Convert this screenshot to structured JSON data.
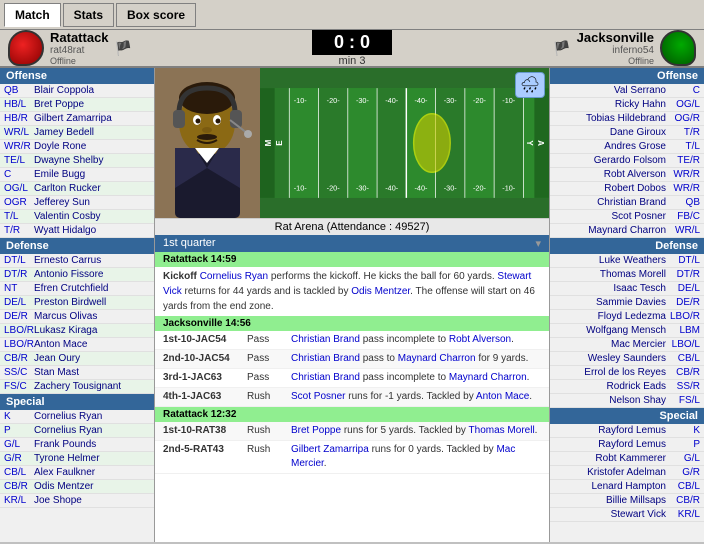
{
  "tabs": [
    {
      "id": "match",
      "label": "Match",
      "active": true
    },
    {
      "id": "stats",
      "label": "Stats",
      "active": false
    },
    {
      "id": "box-score",
      "label": "Box score",
      "active": false
    }
  ],
  "header": {
    "left_team": "Ratattack",
    "left_user": "rat48rat",
    "left_status": "Offline",
    "right_team": "Jacksonville",
    "right_user": "inferno54",
    "right_status": "Offline",
    "score": "0 : 0",
    "time": "min 3"
  },
  "venue": "Rat Arena (Attendance : 49527)",
  "weather_icon": "🌧",
  "left_offense": {
    "header": "Offense",
    "players": [
      {
        "pos": "QB",
        "name": "Blair Coppola"
      },
      {
        "pos": "HB/L",
        "name": "Bret Poppe"
      },
      {
        "pos": "HB/R",
        "name": "Gilbert Zamarripa"
      },
      {
        "pos": "WR/L",
        "name": "Jamey Bedell"
      },
      {
        "pos": "WR/R",
        "name": "Doyle Rone"
      },
      {
        "pos": "TE/L",
        "name": "Dwayne Shelby"
      },
      {
        "pos": "C",
        "name": "Emile Bugg"
      },
      {
        "pos": "OG/L",
        "name": "Carlton Rucker"
      },
      {
        "pos": "OGR",
        "name": "Jefferey Sun"
      },
      {
        "pos": "T/L",
        "name": "Valentin Cosby"
      },
      {
        "pos": "T/R",
        "name": "Wyatt Hidalgo"
      }
    ]
  },
  "left_defense": {
    "header": "Defense",
    "players": [
      {
        "pos": "DT/L",
        "name": "Ernesto Carrus"
      },
      {
        "pos": "DT/R",
        "name": "Antonio Fissore"
      },
      {
        "pos": "NT",
        "name": "Efren Crutchfield"
      },
      {
        "pos": "DE/L",
        "name": "Preston Birdwell"
      },
      {
        "pos": "DE/R",
        "name": "Marcus Olivas"
      },
      {
        "pos": "LBO/R",
        "name": "Lukasz Kiraga"
      },
      {
        "pos": "LBO/R",
        "name": "Anton Mace"
      },
      {
        "pos": "CB/R",
        "name": "Jean Oury"
      },
      {
        "pos": "SS/C",
        "name": "Stan Mast"
      },
      {
        "pos": "FS/C",
        "name": "Zachery Tousignant"
      }
    ]
  },
  "left_special": {
    "header": "Special",
    "players": [
      {
        "pos": "K",
        "name": "Cornelius Ryan"
      },
      {
        "pos": "P",
        "name": "Cornelius Ryan"
      },
      {
        "pos": "G/L",
        "name": "Frank Pounds"
      },
      {
        "pos": "G/R",
        "name": "Tyrone Helmer"
      },
      {
        "pos": "CB/L",
        "name": "Alex Faulkner"
      },
      {
        "pos": "CB/R",
        "name": "Odis Mentzer"
      },
      {
        "pos": "KR/L",
        "name": "Joe Shope"
      }
    ]
  },
  "right_offense": {
    "header": "Offense",
    "players": [
      {
        "pos": "C",
        "name": "Val Serrano"
      },
      {
        "pos": "OG/L",
        "name": "Ricky Hahn"
      },
      {
        "pos": "OG/R",
        "name": "Tobias Hildebrand"
      },
      {
        "pos": "T/R",
        "name": "Dane Giroux"
      },
      {
        "pos": "T/L",
        "name": "Andres Grose"
      },
      {
        "pos": "TE/R",
        "name": "Gerardo Folsom"
      },
      {
        "pos": "WR/R",
        "name": "Robt Alverson"
      },
      {
        "pos": "WR/R",
        "name": "Robert Dobos"
      },
      {
        "pos": "QB",
        "name": "Christian Brand"
      },
      {
        "pos": "FB/C",
        "name": "Scot Posner"
      },
      {
        "pos": "WR/L",
        "name": "Maynard Charron"
      }
    ]
  },
  "right_defense": {
    "header": "Defense",
    "players": [
      {
        "pos": "DT/L",
        "name": "Luke Weathers"
      },
      {
        "pos": "DT/R",
        "name": "Thomas Morell"
      },
      {
        "pos": "DE/L",
        "name": "Isaac Tesch"
      },
      {
        "pos": "DE/R",
        "name": "Sammie Davies"
      },
      {
        "pos": "LBO/R",
        "name": "Floyd Ledezma"
      },
      {
        "pos": "LBM",
        "name": "Wolfgang Mensch"
      },
      {
        "pos": "LBO/L",
        "name": "Mac Mercier"
      },
      {
        "pos": "CB/L",
        "name": "Wesley Saunders"
      },
      {
        "pos": "CB/R",
        "name": "Errol de los Reyes"
      },
      {
        "pos": "SS/R",
        "name": "Rodrick Eads"
      },
      {
        "pos": "FS/L",
        "name": "Nelson Shay"
      }
    ]
  },
  "right_special": {
    "header": "Special",
    "players": [
      {
        "pos": "K",
        "name": "Rayford Lemus"
      },
      {
        "pos": "P",
        "name": "Rayford Lemus"
      },
      {
        "pos": "G/L",
        "name": "Robt Kammerer"
      },
      {
        "pos": "G/R",
        "name": "Kristofer Adelman"
      },
      {
        "pos": "CB/L",
        "name": "Lenard Hampton"
      },
      {
        "pos": "CB/R",
        "name": "Billie Millsaps"
      },
      {
        "pos": "KR/L",
        "name": "Stewart Vick"
      }
    ]
  },
  "play_log": {
    "quarters": [
      {
        "label": "1st quarter",
        "drives": [
          {
            "team": "Ratattack",
            "time": "14:59",
            "plays": [
              {
                "down": "Kickoff",
                "type": "",
                "desc": "Cornelius Ryan performs the kickoff. He kicks the ball for 60 yards. Stewart Vick returns for 44 yards and is tackled by Odis Mentzer. The offense will start on 46 yards from the end zone."
              }
            ]
          },
          {
            "team": "Jacksonville",
            "time": "14:56",
            "plays": [
              {
                "down": "1st-10-JAC54",
                "type": "Pass",
                "desc": "Christian Brand pass incomplete to Robt Alverson."
              },
              {
                "down": "2nd-10-JAC54",
                "type": "Pass",
                "desc": "Christian Brand pass to Maynard Charron for 9 yards."
              },
              {
                "down": "3rd-1-JAC63",
                "type": "Pass",
                "desc": "Christian Brand pass incomplete to Maynard Charron."
              },
              {
                "down": "4th-1-JAC63",
                "type": "Rush",
                "desc": "Scot Posner runs for -1 yards. Tackled by Anton Mace."
              }
            ]
          },
          {
            "team": "Ratattack",
            "time": "12:32",
            "plays": [
              {
                "down": "1st-10-RAT38",
                "type": "Rush",
                "desc": "Bret Poppe runs for 5 yards. Tackled by Thomas Morell."
              },
              {
                "down": "2nd-5-RAT43",
                "type": "Rush",
                "desc": "Gilbert Zamarripa runs for 0 yards. Tackled by Mac Mercier."
              }
            ]
          }
        ]
      }
    ]
  }
}
